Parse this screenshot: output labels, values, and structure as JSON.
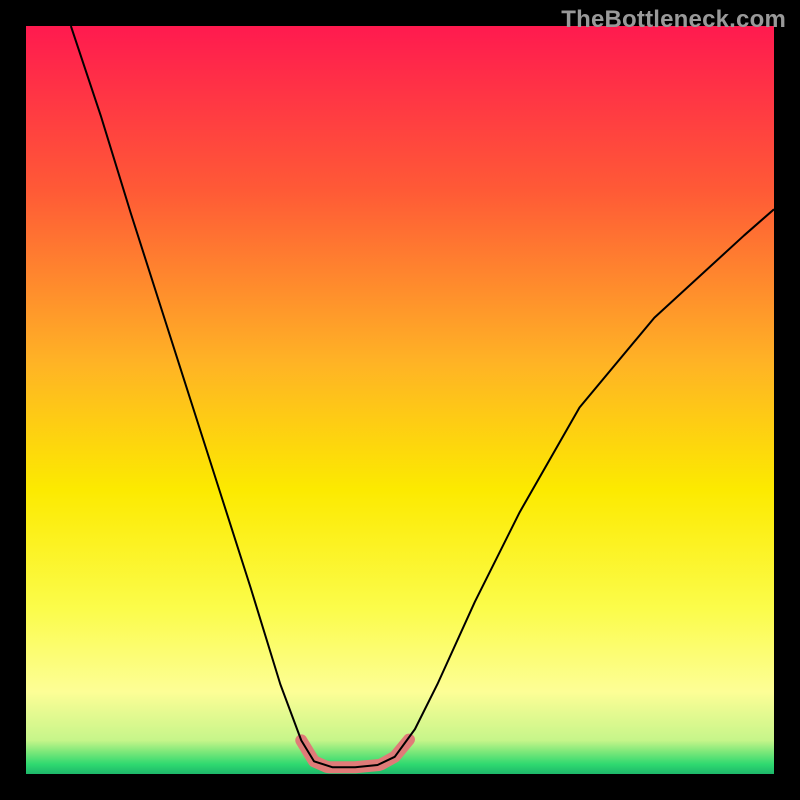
{
  "watermark": "TheBottleneck.com",
  "chart_data": {
    "type": "line",
    "title": "",
    "xlabel": "",
    "ylabel": "",
    "xlim": [
      0,
      100
    ],
    "ylim": [
      0,
      100
    ],
    "background_gradient": {
      "direction": "vertical",
      "stops": [
        {
          "offset": 0.0,
          "color": "#ff1a4f"
        },
        {
          "offset": 0.22,
          "color": "#ff5a36"
        },
        {
          "offset": 0.45,
          "color": "#ffb325"
        },
        {
          "offset": 0.62,
          "color": "#fcea00"
        },
        {
          "offset": 0.78,
          "color": "#fbfc4b"
        },
        {
          "offset": 0.89,
          "color": "#fdfe96"
        },
        {
          "offset": 0.955,
          "color": "#c6f58a"
        },
        {
          "offset": 0.97,
          "color": "#7ee87a"
        },
        {
          "offset": 0.987,
          "color": "#2fd970"
        },
        {
          "offset": 1.0,
          "color": "#1db76a"
        }
      ]
    },
    "series": [
      {
        "name": "bottleneck-curve",
        "color": "#000000",
        "width": 2,
        "x": [
          6,
          10,
          14,
          18,
          22,
          26,
          30,
          34,
          36.8,
          38.5,
          41,
          44,
          47,
          49.3,
          52,
          55,
          60,
          66,
          74,
          84,
          96,
          100
        ],
        "y": [
          100,
          88,
          75,
          62.5,
          50,
          37.5,
          25,
          12,
          4.5,
          1.7,
          0.9,
          0.9,
          1.2,
          2.3,
          6,
          12,
          23,
          35,
          49,
          61,
          72,
          75.5
        ]
      },
      {
        "name": "highlight-segments",
        "color": "#e07b78",
        "width": 12,
        "linecap": "round",
        "segments": [
          {
            "x": [
              36.8,
              38.5,
              40.2
            ],
            "y": [
              4.5,
              1.7,
              0.95
            ]
          },
          {
            "x": [
              40.5,
              44,
              47.2
            ],
            "y": [
              0.9,
              0.9,
              1.2
            ]
          },
          {
            "x": [
              47.5,
              49.3,
              51.2
            ],
            "y": [
              1.3,
              2.3,
              4.6
            ]
          }
        ]
      }
    ]
  }
}
